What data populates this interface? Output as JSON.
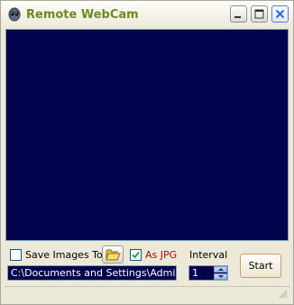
{
  "window": {
    "title": "Remote WebCam",
    "app_icon": "alien-head-icon",
    "controls": [
      "minimize-icon",
      "maximize-icon",
      "close-icon"
    ]
  },
  "controls": {
    "save_images_label": "Save Images To",
    "save_images_checked": false,
    "folder_icon": "folder-open-icon",
    "as_jpg_label": "As JPG",
    "as_jpg_checked": true,
    "interval_label": "Interval",
    "path_value": "C:\\Documents and Settings\\Administr",
    "interval_value": "1",
    "start_label": "Start"
  },
  "colors": {
    "video_background": "#02024d",
    "title_text": "#6e8a1f",
    "as_jpg_text": "#a01010",
    "close_button": "#2e6ad8"
  }
}
